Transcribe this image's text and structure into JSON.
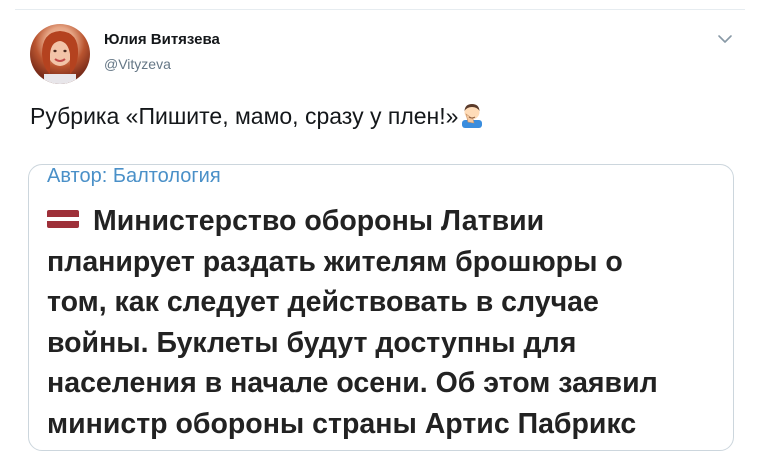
{
  "author": {
    "name": "Юлия Витязева",
    "handle": "@Vityzeva"
  },
  "tweet": {
    "text": "Рубрика «Пишите, мамо, сразу у плен!»",
    "emoji": "man-facepalming-icon"
  },
  "card": {
    "source": "Автор: Балтология",
    "flag": "latvia-flag-icon",
    "lines": [
      "Министерство обороны Латвии",
      "планирует раздать жителям брошюры о",
      "том, как следует действовать в случае",
      "войны. Буклеты будут доступны для",
      "населения в начале осени. Об этом заявил",
      "министр обороны страны Артис Пабрикс"
    ]
  },
  "colors": {
    "link": "#4a90c8",
    "secondary_text": "#657786",
    "border": "#ccd6dd",
    "flag_red": "#9e3039"
  }
}
